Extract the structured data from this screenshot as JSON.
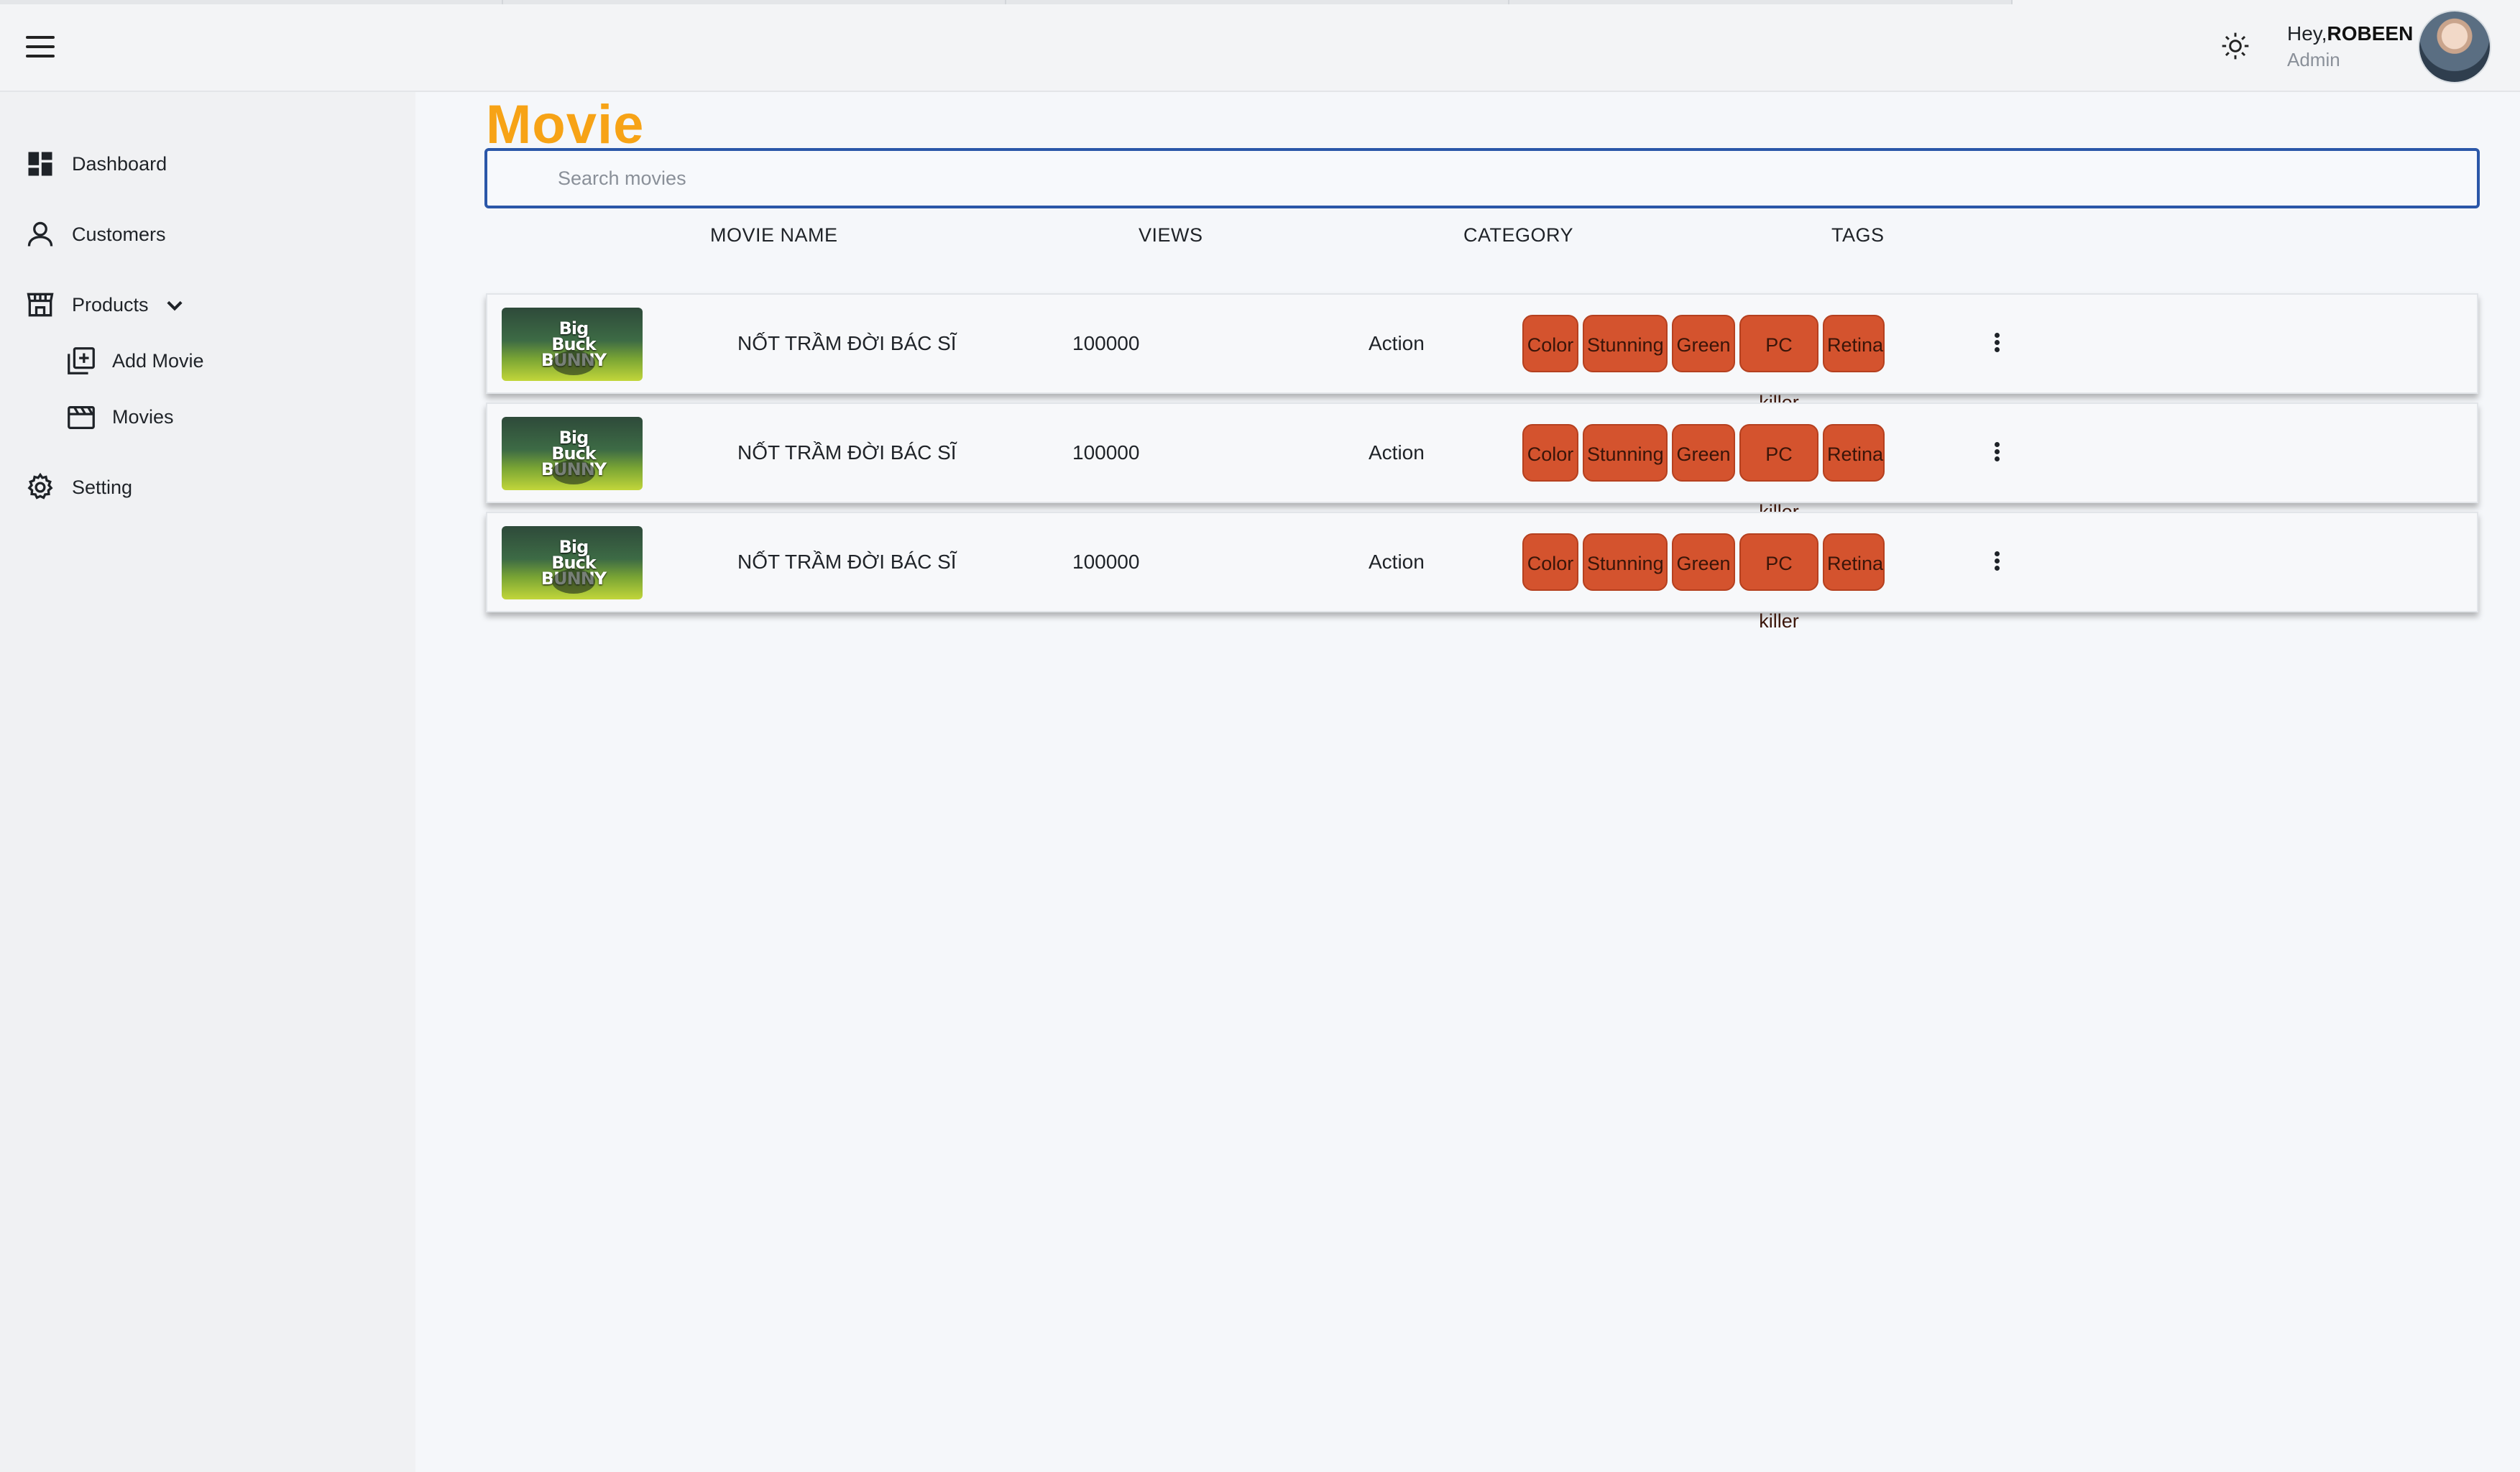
{
  "header": {
    "greeting_prefix": "Hey,",
    "user_name": "ROBEEN",
    "role": "Admin",
    "menu_icon": "hamburger-icon",
    "theme_icon": "sun-icon"
  },
  "sidebar": {
    "items": [
      {
        "label": "Dashboard",
        "icon": "dashboard-icon"
      },
      {
        "label": "Customers",
        "icon": "user-icon"
      },
      {
        "label": "Products",
        "icon": "store-icon"
      },
      {
        "label": "Add Movie",
        "icon": "add-box-icon"
      },
      {
        "label": "Movies",
        "icon": "clapperboard-icon"
      },
      {
        "label": "Setting",
        "icon": "gear-icon"
      }
    ]
  },
  "main": {
    "title": "Movie",
    "search": {
      "placeholder": "Search movies",
      "value": ""
    },
    "columns": [
      "MOVIE NAME",
      "VIEWS",
      "CATEGORY",
      "TAGS"
    ],
    "rows": [
      {
        "thumb_text": "Big Buck BUNNY",
        "name": "NỐT TRẦM ĐỜI BÁC SĨ",
        "views": "100000",
        "category": "Action",
        "tags": [
          "Color",
          "Stunning",
          "Green",
          "PC killer",
          "Retina"
        ]
      },
      {
        "thumb_text": "Big Buck BUNNY",
        "name": "NỐT TRẦM ĐỜI BÁC SĨ",
        "views": "100000",
        "category": "Action",
        "tags": [
          "Color",
          "Stunning",
          "Green",
          "PC killer",
          "Retina"
        ]
      },
      {
        "thumb_text": "Big Buck BUNNY",
        "name": "NỐT TRẦM ĐỜI BÁC SĨ",
        "views": "100000",
        "category": "Action",
        "tags": [
          "Color",
          "Stunning",
          "Green",
          "PC killer",
          "Retina"
        ]
      }
    ]
  },
  "colors": {
    "accent": "#f7a316",
    "tag": "#d4532e",
    "search_border": "#2b57a8"
  }
}
